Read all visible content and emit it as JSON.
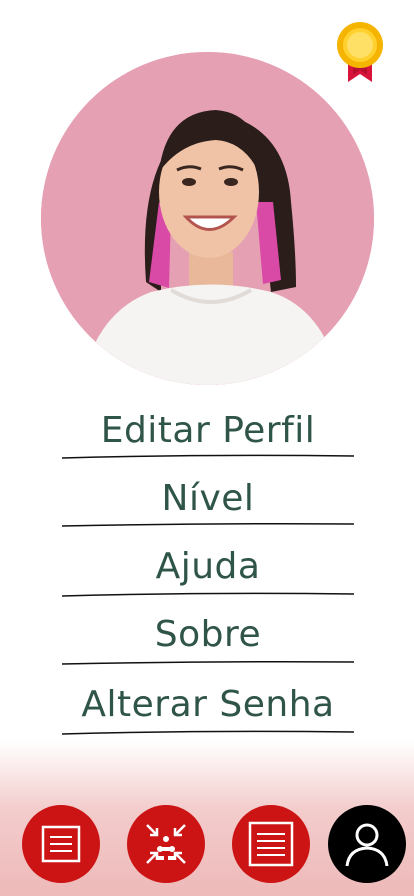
{
  "profile": {
    "badge_icon": "award-medal-icon",
    "avatar_icon": "profile-photo"
  },
  "menu": {
    "items": [
      {
        "label": "Editar Perfil"
      },
      {
        "label": "Nível"
      },
      {
        "label": "Ajuda"
      },
      {
        "label": "Sobre"
      },
      {
        "label": "Alterar Senha"
      }
    ]
  },
  "nav": {
    "items": [
      {
        "icon": "document-icon"
      },
      {
        "icon": "group-arrows-icon"
      },
      {
        "icon": "list-document-icon"
      },
      {
        "icon": "user-profile-icon",
        "active": true
      }
    ]
  },
  "colors": {
    "text": "#2f5448",
    "nav_red": "#cc1414",
    "nav_active": "#000000",
    "avatar_bg": "#e6a0b4"
  }
}
